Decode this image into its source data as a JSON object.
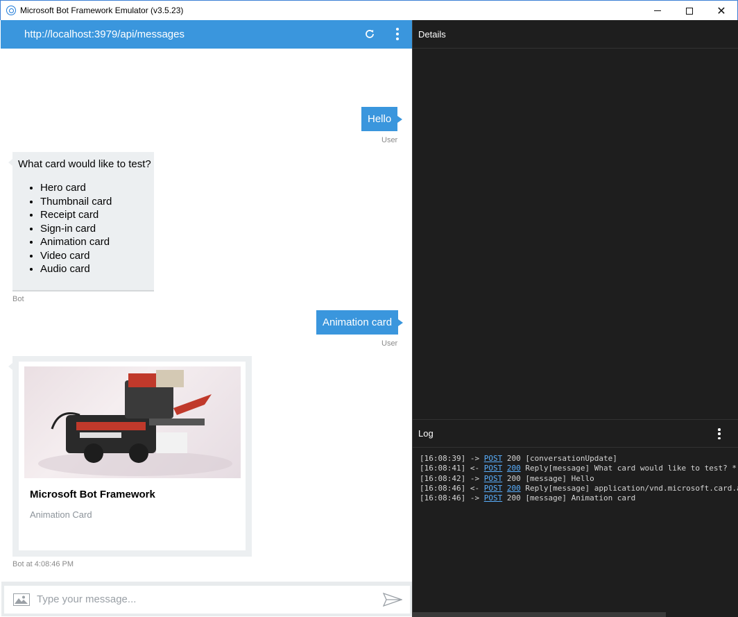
{
  "window": {
    "title": "Microsoft Bot Framework Emulator (v3.5.23)"
  },
  "chat": {
    "endpoint_url": "http://localhost:3979/api/messages",
    "messages": {
      "user1": {
        "text": "Hello",
        "meta": "User"
      },
      "bot1": {
        "question": "What card would like to test?",
        "options": [
          "Hero card",
          "Thumbnail card",
          "Receipt card",
          "Sign-in card",
          "Animation card",
          "Video card",
          "Audio card"
        ],
        "meta": "Bot"
      },
      "user2": {
        "text": "Animation card",
        "meta": "User"
      },
      "bot2": {
        "card_title": "Microsoft Bot Framework",
        "card_subtitle": "Animation Card",
        "meta": "Bot at 4:08:46 PM"
      }
    },
    "composer": {
      "placeholder": "Type your message..."
    }
  },
  "details": {
    "title": "Details"
  },
  "log": {
    "title": "Log",
    "entries": [
      {
        "time": "[16:08:39]",
        "dir": "->",
        "method": "POST",
        "status": "200",
        "status_link": false,
        "text": "[conversationUpdate]"
      },
      {
        "time": "[16:08:41]",
        "dir": "<-",
        "method": "POST",
        "status": "200",
        "status_link": true,
        "text": "Reply[message] What card would like to test? * Hero card"
      },
      {
        "time": "[16:08:42]",
        "dir": "->",
        "method": "POST",
        "status": "200",
        "status_link": false,
        "text": "[message] Hello"
      },
      {
        "time": "[16:08:46]",
        "dir": "<-",
        "method": "POST",
        "status": "200",
        "status_link": true,
        "text": "Reply[message] application/vnd.microsoft.card.animation"
      },
      {
        "time": "[16:08:46]",
        "dir": "->",
        "method": "POST",
        "status": "200",
        "status_link": false,
        "text": "[message] Animation card"
      }
    ]
  },
  "colors": {
    "accent": "#3a96dd",
    "bot_bubble": "#eceff1",
    "dark_panel": "#1e1e1e",
    "log_link": "#5ab0ff"
  },
  "icons": {
    "refresh": "refresh-icon",
    "more": "more-vertical-icon",
    "attach_image": "image-icon",
    "send": "send-icon"
  }
}
